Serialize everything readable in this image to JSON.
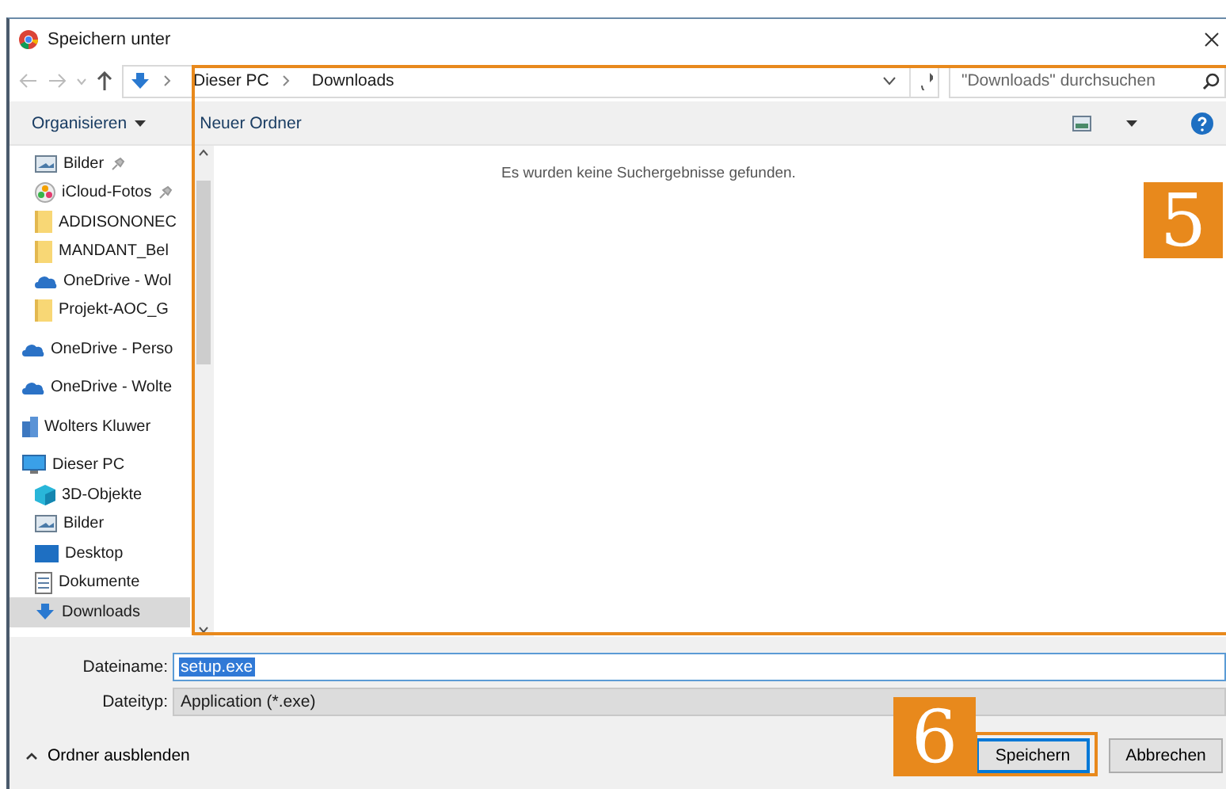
{
  "window": {
    "title": "Speichern unter"
  },
  "address_bar": {
    "path": [
      "Dieser PC",
      "Downloads"
    ]
  },
  "search": {
    "placeholder": "\"Downloads\" durchsuchen"
  },
  "toolbar": {
    "organize": "Organisieren",
    "new_folder": "Neuer Ordner"
  },
  "sidebar": {
    "pinned_items": [
      {
        "label": "Bilder",
        "kind": "picture",
        "pinned": true,
        "selected": false
      },
      {
        "label": "iCloud-Fotos",
        "kind": "photos",
        "pinned": true,
        "selected": false
      },
      {
        "label": "ADDISONONEC",
        "kind": "folder",
        "pinned": false,
        "selected": false
      },
      {
        "label": "MANDANT_Bel",
        "kind": "folder",
        "pinned": false,
        "selected": false
      },
      {
        "label": "OneDrive - Wol",
        "kind": "cloud",
        "pinned": false,
        "selected": false
      },
      {
        "label": "Projekt-AOC_G",
        "kind": "folder",
        "pinned": false,
        "selected": false
      }
    ],
    "items": [
      {
        "label": "OneDrive - Perso",
        "kind": "cloud",
        "selected": false
      },
      {
        "label": "OneDrive - Wolte",
        "kind": "cloud",
        "selected": false
      },
      {
        "label": "Wolters Kluwer",
        "kind": "building",
        "selected": false
      },
      {
        "label": "Dieser PC",
        "kind": "pc",
        "selected": false,
        "children": [
          {
            "label": "3D-Objekte",
            "kind": "cube",
            "selected": false
          },
          {
            "label": "Bilder",
            "kind": "picture",
            "selected": false
          },
          {
            "label": "Desktop",
            "kind": "desktop",
            "selected": false
          },
          {
            "label": "Dokumente",
            "kind": "document",
            "selected": false
          },
          {
            "label": "Downloads",
            "kind": "download",
            "selected": true
          }
        ]
      }
    ]
  },
  "content": {
    "empty_message": "Es wurden keine Suchergebnisse gefunden."
  },
  "form": {
    "file_name_label": "Dateiname:",
    "file_name": "setup.exe",
    "file_name_highlighted": true,
    "file_type_label": "Dateityp:",
    "file_type": "Application (*.exe)"
  },
  "footer": {
    "hide_folders": "Ordner ausblenden",
    "buttons": [
      {
        "label": "Speichern",
        "default": true
      },
      {
        "label": "Abbrechen",
        "default": false
      }
    ]
  },
  "callouts": [
    {
      "label": "5"
    },
    {
      "label": "6"
    }
  ]
}
